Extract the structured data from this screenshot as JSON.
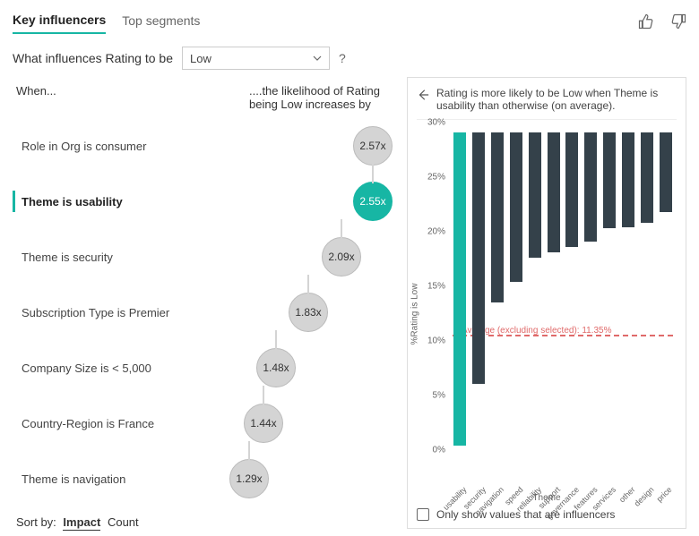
{
  "tabs": {
    "key_influencers": "Key influencers",
    "top_segments": "Top segments"
  },
  "prompt": {
    "text": "What influences Rating to be",
    "selected": "Low",
    "help": "?"
  },
  "left": {
    "when_header": "When...",
    "likelihood_header": "....the likelihood of Rating being Low increases by",
    "sort_label": "Sort by:",
    "sort_impact": "Impact",
    "sort_count": "Count"
  },
  "influencers": [
    {
      "label": "Role in Org is consumer",
      "value": "2.57x",
      "selected": false
    },
    {
      "label": "Theme is usability",
      "value": "2.55x",
      "selected": true
    },
    {
      "label": "Theme is security",
      "value": "2.09x",
      "selected": false
    },
    {
      "label": "Subscription Type is Premier",
      "value": "1.83x",
      "selected": false
    },
    {
      "label": "Company Size is < 5,000",
      "value": "1.48x",
      "selected": false
    },
    {
      "label": "Country-Region is France",
      "value": "1.44x",
      "selected": false
    },
    {
      "label": "Theme is navigation",
      "value": "1.29x",
      "selected": false
    }
  ],
  "right": {
    "insight": "Rating is more likely to be Low when Theme is usability than otherwise (on average).",
    "avg_label": "Average (excluding selected): 11.35%",
    "only_checkbox": "Only show values that are influencers"
  },
  "chart_data": {
    "type": "bar",
    "title": "",
    "ylabel": "%Rating is Low",
    "xlabel": "Theme",
    "ylim": [
      0,
      30
    ],
    "yticks": [
      "0%",
      "5%",
      "10%",
      "15%",
      "20%",
      "25%",
      "30%"
    ],
    "avg_value": 11.35,
    "selected_category": "usability",
    "categories": [
      "usability",
      "security",
      "navigation",
      "speed",
      "reliability",
      "support",
      "governance",
      "features",
      "services",
      "other",
      "design",
      "price"
    ],
    "values": [
      28.7,
      23.0,
      15.6,
      13.7,
      11.5,
      11.0,
      10.5,
      10.0,
      8.8,
      8.7,
      8.3,
      7.3
    ]
  }
}
